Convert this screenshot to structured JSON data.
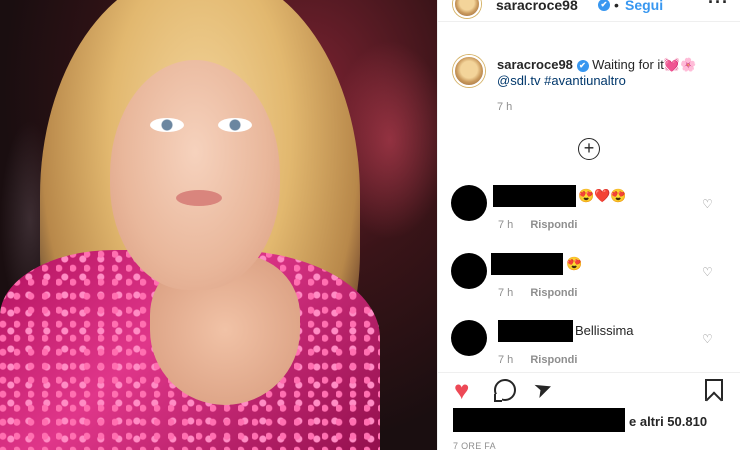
{
  "header": {
    "username": "saracroce98",
    "verified_mark": "✔",
    "separator": "•",
    "follow_label": "Segui",
    "more_label": "···"
  },
  "caption": {
    "username": "saracroce98",
    "verified_mark": "✔",
    "text": "Waiting for it💓🌸",
    "mention": "@sdl.tv",
    "hashtag": "#avantiunaltro",
    "time": "7 h"
  },
  "add_icon": "+",
  "comments": [
    {
      "text": "😍❤️😍",
      "time": "7 h",
      "reply_label": "Rispondi"
    },
    {
      "text": "😍",
      "time": "7 h",
      "reply_label": "Rispondi"
    },
    {
      "text": "Bellissima",
      "time": "7 h",
      "reply_label": "Rispondi"
    }
  ],
  "comment_like_icon": "♡",
  "actions": {
    "like_icon": "♥",
    "share_icon": "➤",
    "like_color": "#ed4956"
  },
  "likes": {
    "text": "e altri 50.810"
  },
  "post_date": "7 ORE FA",
  "colors": {
    "link": "#3897f0",
    "mention": "#00376b",
    "muted": "#8e8e8e"
  }
}
